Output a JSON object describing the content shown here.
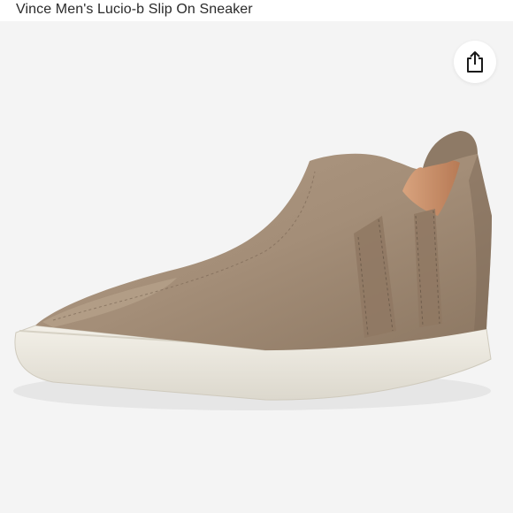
{
  "header": {
    "title": "Vince Men's Lucio-b Slip On Sneaker"
  },
  "viewer": {
    "share_icon": "share-icon",
    "product_image_icon": "slip-on-sneaker-image"
  },
  "colors": {
    "suede": "#a48e78",
    "sole": "#ece9e0",
    "background": "#f4f4f4"
  }
}
